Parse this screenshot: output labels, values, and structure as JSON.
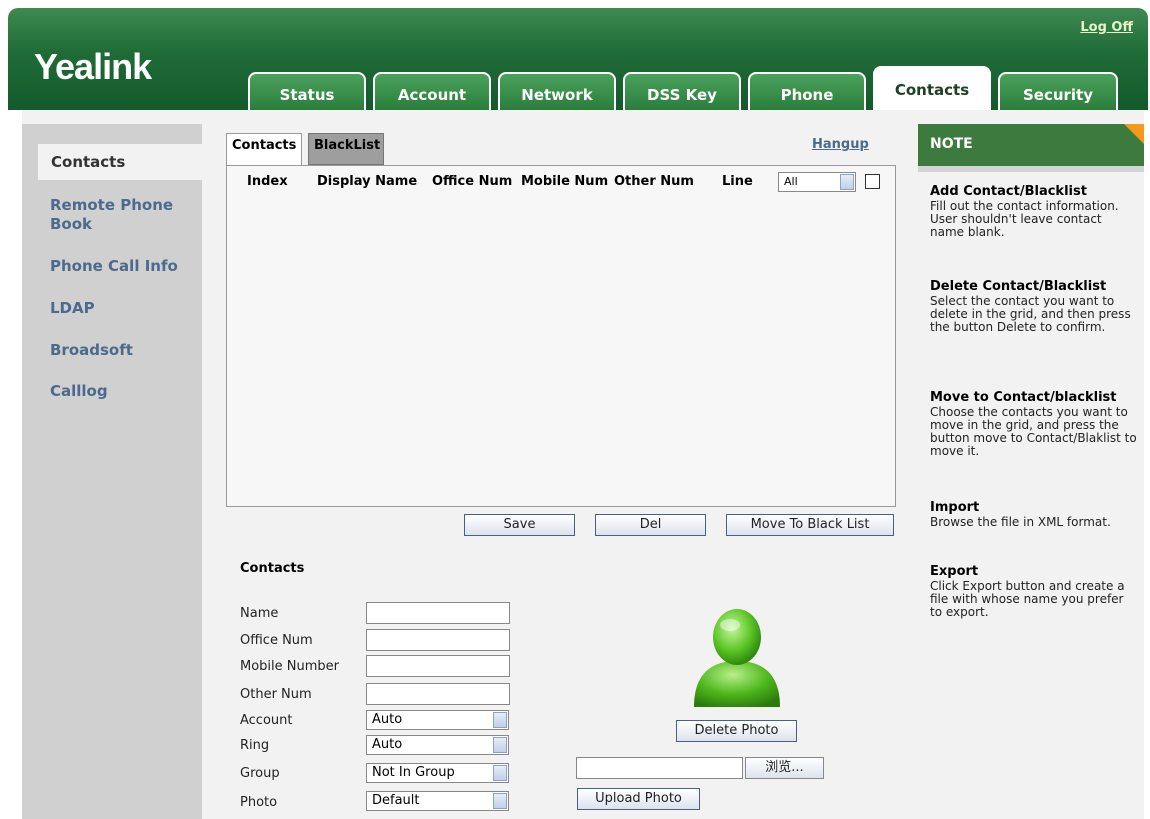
{
  "header": {
    "logo": "Yealink",
    "logoff": "Log Off"
  },
  "tabs": [
    {
      "label": "Status"
    },
    {
      "label": "Account"
    },
    {
      "label": "Network"
    },
    {
      "label": "DSS Key"
    },
    {
      "label": "Phone"
    },
    {
      "label": "Contacts"
    },
    {
      "label": "Security"
    }
  ],
  "sidebar": {
    "active": "Contacts",
    "items": [
      {
        "label": "Remote Phone Book"
      },
      {
        "label": "Phone Call Info"
      },
      {
        "label": "LDAP"
      },
      {
        "label": "Broadsoft"
      },
      {
        "label": "Calllog"
      }
    ]
  },
  "subtabs": {
    "contacts": "Contacts",
    "blacklist": "BlackList",
    "hangup": "Hangup"
  },
  "grid": {
    "columns": [
      "Index",
      "Display Name",
      "Office Num",
      "Mobile Num",
      "Other Num",
      "Line"
    ],
    "line_filter": "All"
  },
  "actions": {
    "save": "Save",
    "del": "Del",
    "move": "Move To Black List"
  },
  "form": {
    "title": "Contacts",
    "labels": {
      "name": "Name",
      "office": "Office Num",
      "mobile": "Mobile Number",
      "other": "Other Num",
      "account": "Account",
      "ring": "Ring",
      "group": "Group",
      "photo": "Photo"
    },
    "values": {
      "account": "Auto",
      "ring": "Auto",
      "group": "Not In Group",
      "photo": "Default"
    },
    "delete_photo": "Delete Photo",
    "browse": "浏览...",
    "upload_photo": "Upload Photo"
  },
  "note": {
    "title": "NOTE",
    "sections": [
      {
        "title": "Add Contact/Blacklist",
        "text": "Fill out the contact information. User shouldn't leave contact name blank."
      },
      {
        "title": "Delete Contact/Blacklist",
        "text": "Select the contact you want to delete in the grid, and then press the button Delete to confirm."
      },
      {
        "title": "Move to Contact/blacklist",
        "text": "Choose the contacts you want to move in the grid, and press the button move to Contact/Blaklist to move it."
      },
      {
        "title": "Import",
        "text": "Browse the file in XML format."
      },
      {
        "title": "Export",
        "text": "Click Export button and create a file with whose name you prefer to export."
      }
    ]
  },
  "colors": {
    "header_green": "#1f6b36",
    "sidebar_link": "#4b6a8d",
    "note_head": "#3c7a3e",
    "note_corner": "#f39a1b"
  }
}
